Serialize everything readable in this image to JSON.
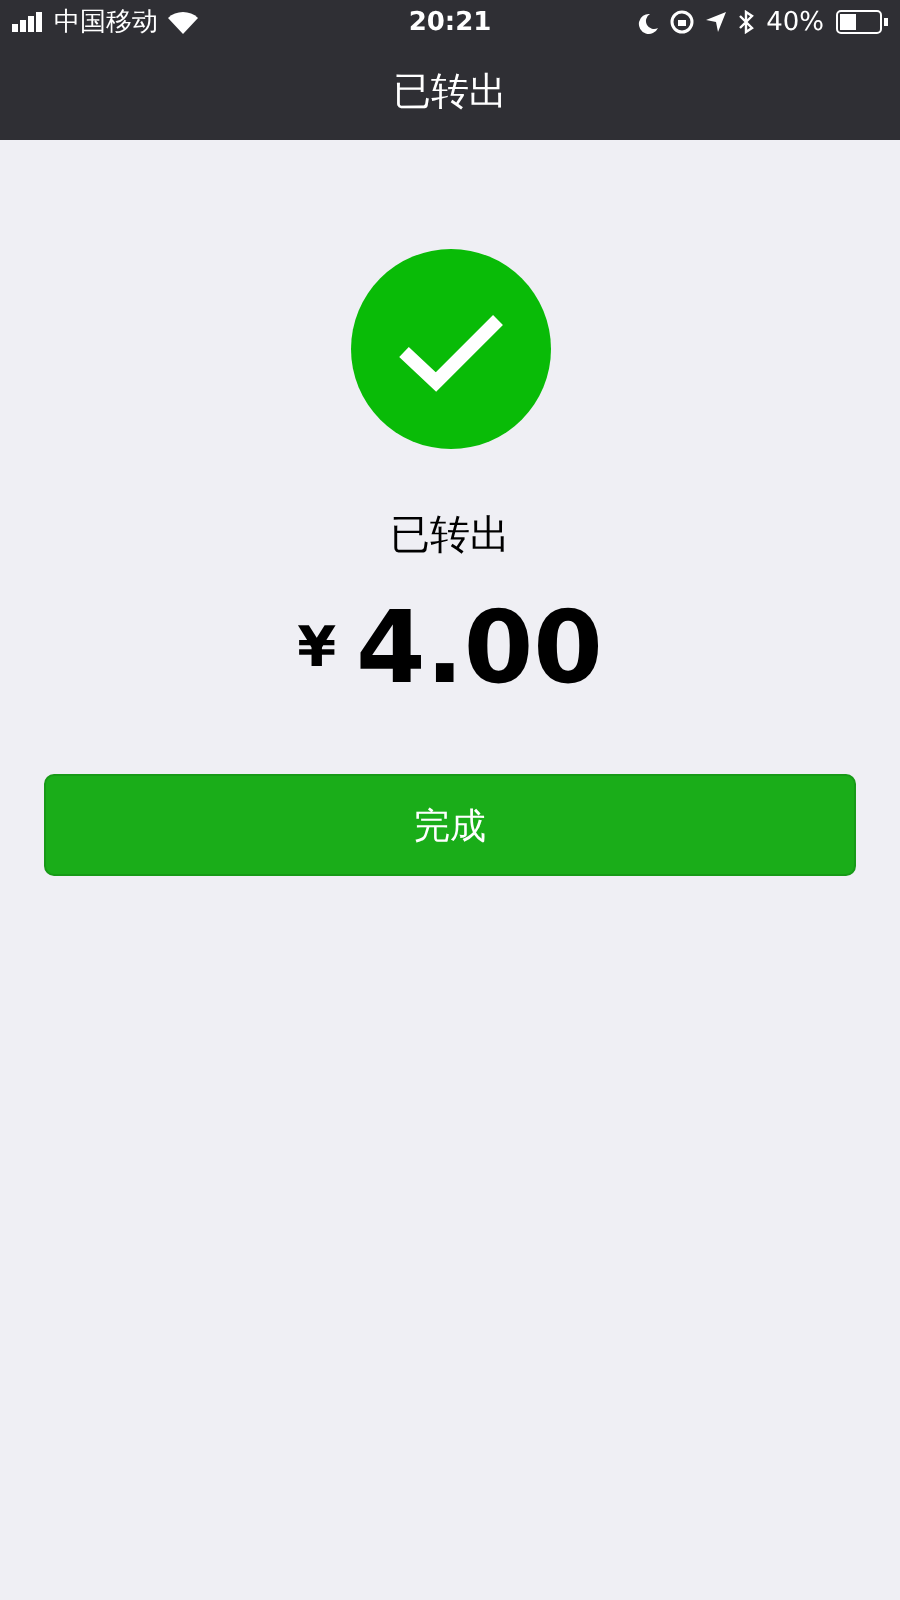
{
  "status_bar": {
    "carrier": "中国移动",
    "time": "20:21",
    "battery": "40%"
  },
  "nav_bar": {
    "title": "已转出"
  },
  "result": {
    "message": "已转出",
    "currency": "¥",
    "amount": "4.00"
  },
  "buttons": [
    {
      "label": "完成"
    }
  ]
}
